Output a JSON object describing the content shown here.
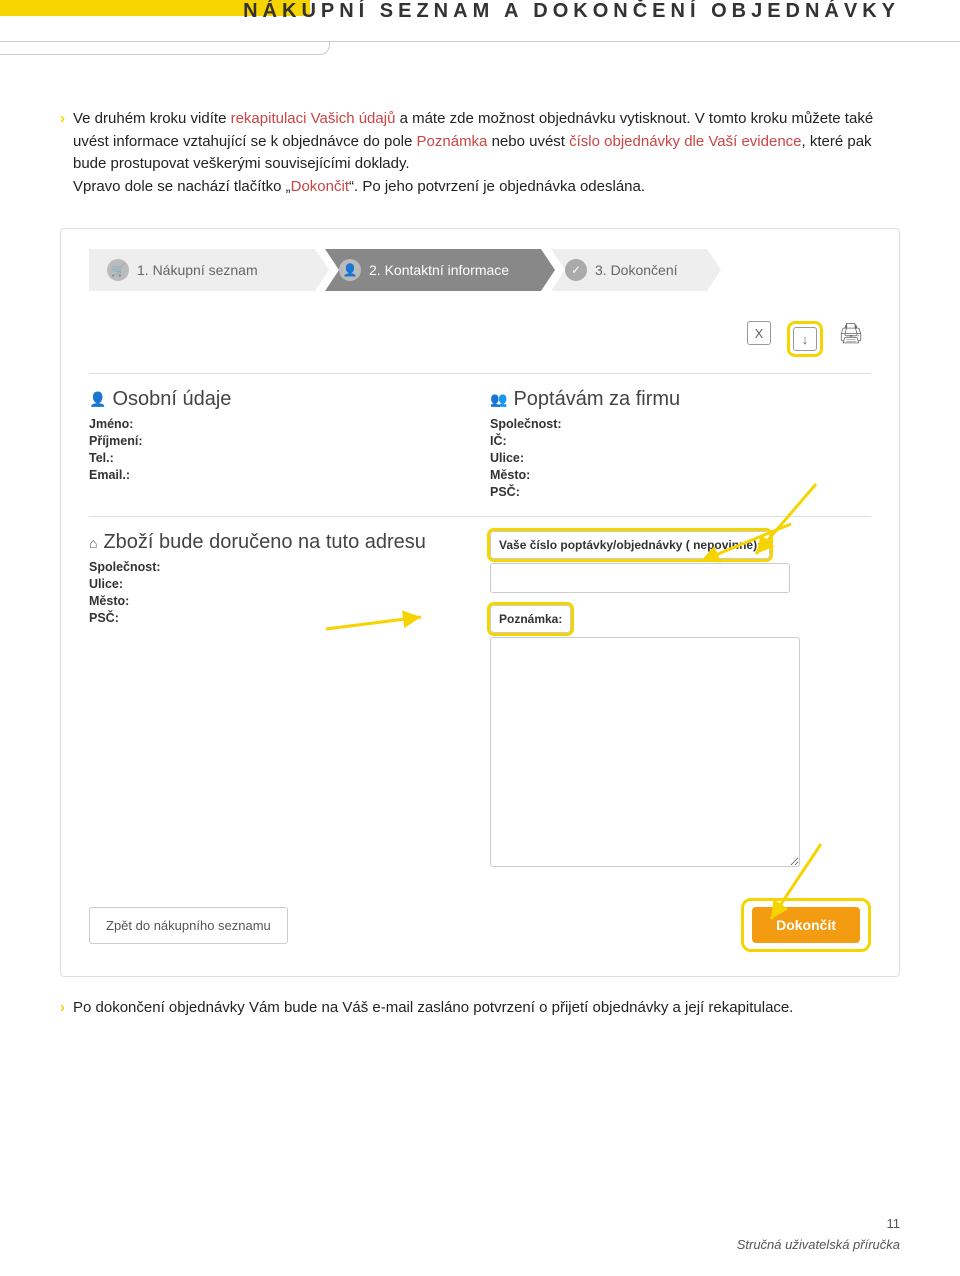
{
  "header": {
    "title": "NÁKUPNÍ SEZNAM A DOKONČENÍ OBJEDNÁVKY"
  },
  "paragraph1": {
    "pre": "Ve druhém kroku vidíte ",
    "red1": "rekapitulaci Vašich údajů",
    "mid1": " a máte zde možnost objednávku vytisknout. V tomto kroku můžete také uvést informace vztahující se k objednávce do pole ",
    "red2": "Poznámka",
    "mid2": " nebo uvést ",
    "red3": "číslo objednávky dle Vaší evidence",
    "mid3": ", které pak bude prostupovat veškerými souvisejícími doklady.",
    "line2a": "Vpravo dole se nachází tlačítko „",
    "red4": "Dokončit",
    "line2b": "“. Po jeho potvrzení je objednávka odeslána."
  },
  "steps": {
    "s1": "1. Nákupní seznam",
    "s2": "2. Kontaktní informace",
    "s3": "3. Dokončení"
  },
  "icons": {
    "excel": "X",
    "pdf": "↓",
    "print": "🖨"
  },
  "sections": {
    "personal": "Osobní údaje",
    "company": "Poptávám za firmu",
    "address": "Zboží bude doručeno na tuto adresu"
  },
  "fields": {
    "jmeno": "Jméno:",
    "prijmeni": "Příjmení:",
    "tel": "Tel.:",
    "email": "Email.:",
    "spolecnost": "Společnost:",
    "ic": "IČ:",
    "ulice": "Ulice:",
    "mesto": "Město:",
    "psc": "PSČ:"
  },
  "inputs": {
    "order_no_label": "Vaše číslo poptávky/objednávky ( nepovinné):",
    "note_label": "Poznámka:"
  },
  "buttons": {
    "back": "Zpět do nákupního seznamu",
    "finish": "Dokončit"
  },
  "paragraph2": "Po dokončení objednávky Vám bude na Váš e-mail zasláno potvrzení o přijetí objednávky a její rekapitulace.",
  "footer": {
    "page": "11",
    "guide": "Stručná uživatelská příručka"
  }
}
